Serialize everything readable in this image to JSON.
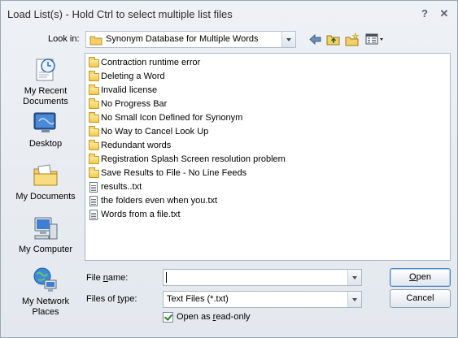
{
  "window": {
    "title": "Load List(s) - Hold Ctrl to select multiple list files",
    "help_glyph": "?",
    "close_glyph": "✕"
  },
  "lookin": {
    "label": "Look in:",
    "value": "Synonym Database for Multiple Words",
    "nav_icons": [
      "back-arrow-icon",
      "up-folder-icon",
      "new-folder-icon",
      "views-menu-icon"
    ]
  },
  "places": [
    {
      "label_lines": [
        "My Recent",
        "Documents"
      ],
      "icon": "recent-documents-icon"
    },
    {
      "label_lines": [
        "Desktop"
      ],
      "icon": "desktop-icon"
    },
    {
      "label_lines": [
        "My Documents"
      ],
      "icon": "my-documents-icon"
    },
    {
      "label_lines": [
        "My Computer"
      ],
      "icon": "my-computer-icon"
    },
    {
      "label_lines": [
        "My Network",
        "Places"
      ],
      "icon": "network-places-icon"
    }
  ],
  "files": [
    {
      "name": "Contraction runtime error",
      "type": "folder"
    },
    {
      "name": "Deleting a Word",
      "type": "folder"
    },
    {
      "name": "Invalid license",
      "type": "folder"
    },
    {
      "name": "No Progress Bar",
      "type": "folder"
    },
    {
      "name": "No Small Icon Defined for Synonym",
      "type": "folder"
    },
    {
      "name": "No Way to Cancel Look Up",
      "type": "folder"
    },
    {
      "name": "Redundant words",
      "type": "folder"
    },
    {
      "name": "Registration Splash Screen resolution problem",
      "type": "folder"
    },
    {
      "name": "Save Results to File - No Line Feeds",
      "type": "folder"
    },
    {
      "name": "results..txt",
      "type": "file"
    },
    {
      "name": "the folders even when you.txt",
      "type": "file"
    },
    {
      "name": "Words from a file.txt",
      "type": "file"
    }
  ],
  "filename": {
    "label_prefix": "File ",
    "label_underlined": "n",
    "label_suffix": "ame:",
    "value": ""
  },
  "filetype": {
    "label_prefix": "Files of ",
    "label_underlined": "t",
    "label_suffix": "ype:",
    "value": "Text Files (*.txt)"
  },
  "buttons": {
    "open_underlined": "O",
    "open_rest": "pen",
    "cancel": "Cancel"
  },
  "readonly": {
    "checked": true,
    "label_prefix": "Open as ",
    "label_underlined": "r",
    "label_suffix": "ead-only"
  }
}
